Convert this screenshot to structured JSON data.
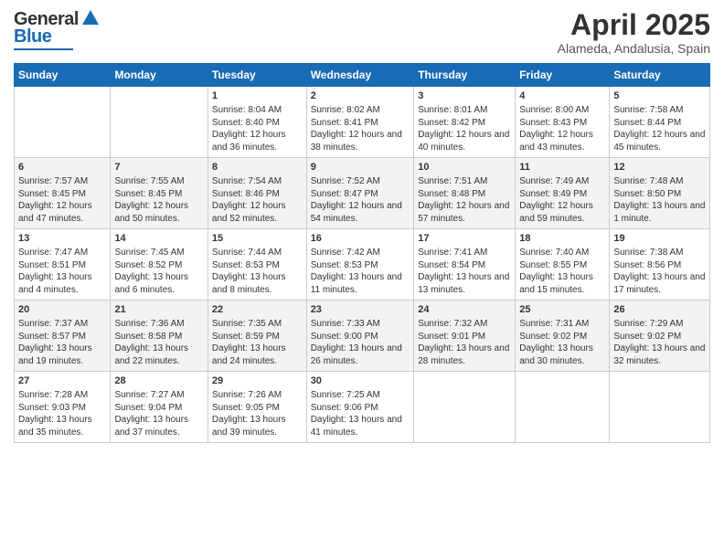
{
  "header": {
    "logo_line1": "General",
    "logo_line2": "Blue",
    "title": "April 2025",
    "subtitle": "Alameda, Andalusia, Spain"
  },
  "days_of_week": [
    "Sunday",
    "Monday",
    "Tuesday",
    "Wednesday",
    "Thursday",
    "Friday",
    "Saturday"
  ],
  "weeks": [
    [
      {
        "day": "",
        "content": []
      },
      {
        "day": "",
        "content": []
      },
      {
        "day": "1",
        "content": [
          "Sunrise: 8:04 AM",
          "Sunset: 8:40 PM",
          "Daylight: 12 hours and 36 minutes."
        ]
      },
      {
        "day": "2",
        "content": [
          "Sunrise: 8:02 AM",
          "Sunset: 8:41 PM",
          "Daylight: 12 hours and 38 minutes."
        ]
      },
      {
        "day": "3",
        "content": [
          "Sunrise: 8:01 AM",
          "Sunset: 8:42 PM",
          "Daylight: 12 hours and 40 minutes."
        ]
      },
      {
        "day": "4",
        "content": [
          "Sunrise: 8:00 AM",
          "Sunset: 8:43 PM",
          "Daylight: 12 hours and 43 minutes."
        ]
      },
      {
        "day": "5",
        "content": [
          "Sunrise: 7:58 AM",
          "Sunset: 8:44 PM",
          "Daylight: 12 hours and 45 minutes."
        ]
      }
    ],
    [
      {
        "day": "6",
        "content": [
          "Sunrise: 7:57 AM",
          "Sunset: 8:45 PM",
          "Daylight: 12 hours and 47 minutes."
        ]
      },
      {
        "day": "7",
        "content": [
          "Sunrise: 7:55 AM",
          "Sunset: 8:45 PM",
          "Daylight: 12 hours and 50 minutes."
        ]
      },
      {
        "day": "8",
        "content": [
          "Sunrise: 7:54 AM",
          "Sunset: 8:46 PM",
          "Daylight: 12 hours and 52 minutes."
        ]
      },
      {
        "day": "9",
        "content": [
          "Sunrise: 7:52 AM",
          "Sunset: 8:47 PM",
          "Daylight: 12 hours and 54 minutes."
        ]
      },
      {
        "day": "10",
        "content": [
          "Sunrise: 7:51 AM",
          "Sunset: 8:48 PM",
          "Daylight: 12 hours and 57 minutes."
        ]
      },
      {
        "day": "11",
        "content": [
          "Sunrise: 7:49 AM",
          "Sunset: 8:49 PM",
          "Daylight: 12 hours and 59 minutes."
        ]
      },
      {
        "day": "12",
        "content": [
          "Sunrise: 7:48 AM",
          "Sunset: 8:50 PM",
          "Daylight: 13 hours and 1 minute."
        ]
      }
    ],
    [
      {
        "day": "13",
        "content": [
          "Sunrise: 7:47 AM",
          "Sunset: 8:51 PM",
          "Daylight: 13 hours and 4 minutes."
        ]
      },
      {
        "day": "14",
        "content": [
          "Sunrise: 7:45 AM",
          "Sunset: 8:52 PM",
          "Daylight: 13 hours and 6 minutes."
        ]
      },
      {
        "day": "15",
        "content": [
          "Sunrise: 7:44 AM",
          "Sunset: 8:53 PM",
          "Daylight: 13 hours and 8 minutes."
        ]
      },
      {
        "day": "16",
        "content": [
          "Sunrise: 7:42 AM",
          "Sunset: 8:53 PM",
          "Daylight: 13 hours and 11 minutes."
        ]
      },
      {
        "day": "17",
        "content": [
          "Sunrise: 7:41 AM",
          "Sunset: 8:54 PM",
          "Daylight: 13 hours and 13 minutes."
        ]
      },
      {
        "day": "18",
        "content": [
          "Sunrise: 7:40 AM",
          "Sunset: 8:55 PM",
          "Daylight: 13 hours and 15 minutes."
        ]
      },
      {
        "day": "19",
        "content": [
          "Sunrise: 7:38 AM",
          "Sunset: 8:56 PM",
          "Daylight: 13 hours and 17 minutes."
        ]
      }
    ],
    [
      {
        "day": "20",
        "content": [
          "Sunrise: 7:37 AM",
          "Sunset: 8:57 PM",
          "Daylight: 13 hours and 19 minutes."
        ]
      },
      {
        "day": "21",
        "content": [
          "Sunrise: 7:36 AM",
          "Sunset: 8:58 PM",
          "Daylight: 13 hours and 22 minutes."
        ]
      },
      {
        "day": "22",
        "content": [
          "Sunrise: 7:35 AM",
          "Sunset: 8:59 PM",
          "Daylight: 13 hours and 24 minutes."
        ]
      },
      {
        "day": "23",
        "content": [
          "Sunrise: 7:33 AM",
          "Sunset: 9:00 PM",
          "Daylight: 13 hours and 26 minutes."
        ]
      },
      {
        "day": "24",
        "content": [
          "Sunrise: 7:32 AM",
          "Sunset: 9:01 PM",
          "Daylight: 13 hours and 28 minutes."
        ]
      },
      {
        "day": "25",
        "content": [
          "Sunrise: 7:31 AM",
          "Sunset: 9:02 PM",
          "Daylight: 13 hours and 30 minutes."
        ]
      },
      {
        "day": "26",
        "content": [
          "Sunrise: 7:29 AM",
          "Sunset: 9:02 PM",
          "Daylight: 13 hours and 32 minutes."
        ]
      }
    ],
    [
      {
        "day": "27",
        "content": [
          "Sunrise: 7:28 AM",
          "Sunset: 9:03 PM",
          "Daylight: 13 hours and 35 minutes."
        ]
      },
      {
        "day": "28",
        "content": [
          "Sunrise: 7:27 AM",
          "Sunset: 9:04 PM",
          "Daylight: 13 hours and 37 minutes."
        ]
      },
      {
        "day": "29",
        "content": [
          "Sunrise: 7:26 AM",
          "Sunset: 9:05 PM",
          "Daylight: 13 hours and 39 minutes."
        ]
      },
      {
        "day": "30",
        "content": [
          "Sunrise: 7:25 AM",
          "Sunset: 9:06 PM",
          "Daylight: 13 hours and 41 minutes."
        ]
      },
      {
        "day": "",
        "content": []
      },
      {
        "day": "",
        "content": []
      },
      {
        "day": "",
        "content": []
      }
    ]
  ]
}
